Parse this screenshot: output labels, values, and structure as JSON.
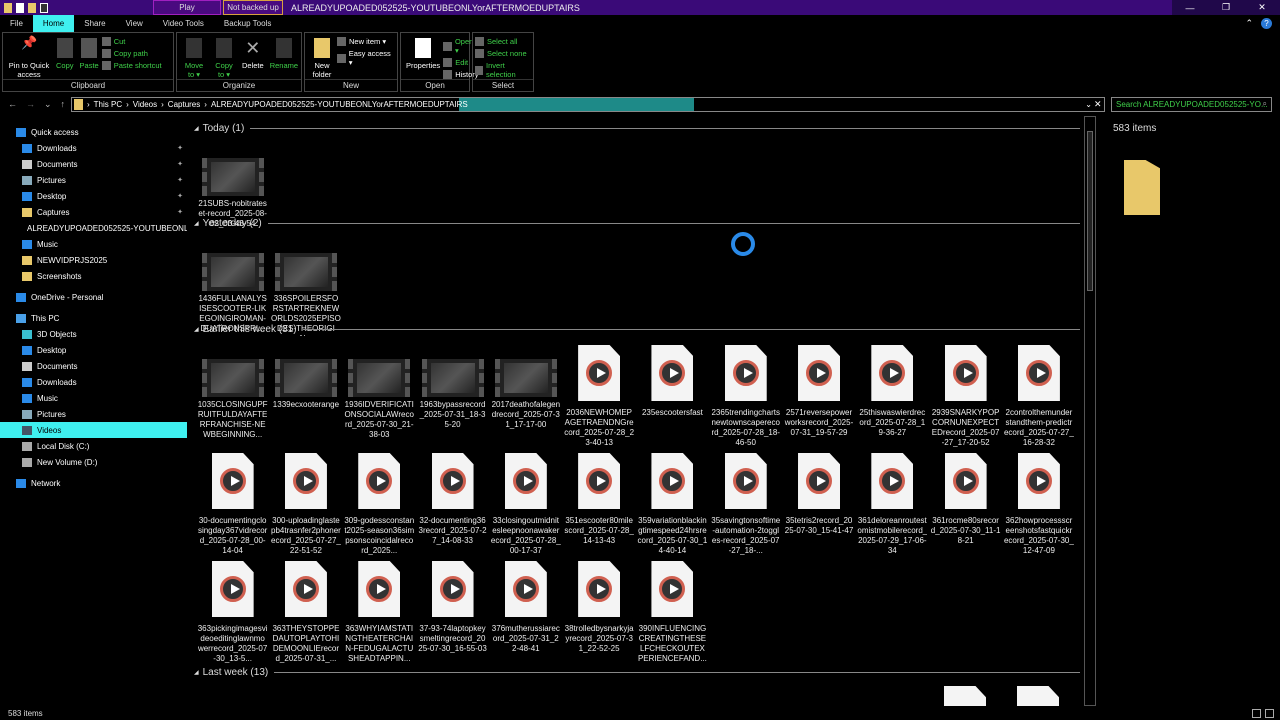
{
  "titlebar": {
    "play": "Play",
    "not_backed_up": "Not backed up",
    "title": "ALREADYUPOADED052525-YOUTUBEONLYorAFTERMOEDUPTAIRS",
    "min": "—",
    "max": "❐",
    "close": "✕"
  },
  "tabs": [
    "File",
    "Home",
    "Share",
    "View",
    "Video Tools",
    "Backup Tools"
  ],
  "ribbon": {
    "clipboard": {
      "label": "Clipboard",
      "pin": "Pin to Quick access",
      "copy": "Copy",
      "paste": "Paste",
      "cut": "Cut",
      "copy_path": "Copy path",
      "paste_shortcut": "Paste shortcut"
    },
    "organize": {
      "label": "Organize",
      "move_to": "Move to ▾",
      "copy_to": "Copy to ▾",
      "delete": "Delete",
      "rename": "Rename"
    },
    "new": {
      "label": "New",
      "new_folder": "New folder",
      "new_item": "New item ▾",
      "easy_access": "Easy access ▾"
    },
    "open": {
      "label": "Open",
      "properties": "Properties",
      "open": "Open ▾",
      "edit": "Edit",
      "history": "History"
    },
    "select": {
      "label": "Select",
      "select_all": "Select all",
      "select_none": "Select none",
      "invert": "Invert selection"
    }
  },
  "address": {
    "path": [
      "This PC",
      "Videos",
      "Captures",
      "ALREADYUPOADED052525-YOUTUBEONLYorAFTERMOEDUPTAIRS"
    ],
    "search_placeholder": "Search ALREADYUPOADED052525-YO..."
  },
  "sidebar": [
    {
      "label": "Quick access",
      "level": 0,
      "color": "#2a8ae8"
    },
    {
      "label": "Downloads",
      "level": 1,
      "pin": true,
      "color": "#2a8ae8"
    },
    {
      "label": "Documents",
      "level": 1,
      "pin": true,
      "color": "#ccc"
    },
    {
      "label": "Pictures",
      "level": 1,
      "pin": true,
      "color": "#8ab"
    },
    {
      "label": "Desktop",
      "level": 1,
      "pin": true,
      "color": "#2a8ae8"
    },
    {
      "label": "Captures",
      "level": 1,
      "pin": true,
      "color": "#e8c86a"
    },
    {
      "label": "ALREADYUPOADED052525-YOUTUBEONLYorAFTERMOEDUPTAIRS",
      "level": 1,
      "color": "#e8c86a"
    },
    {
      "label": "Music",
      "level": 1,
      "color": "#2a8ae8"
    },
    {
      "label": "NEWVIDPRJS2025",
      "level": 1,
      "color": "#e8c86a"
    },
    {
      "label": "Screenshots",
      "level": 1,
      "color": "#e8c86a"
    },
    {
      "label": "OneDrive - Personal",
      "level": 0,
      "gap": true,
      "color": "#2a8ae8"
    },
    {
      "label": "This PC",
      "level": 0,
      "gap": true,
      "color": "#4aa0e8"
    },
    {
      "label": "3D Objects",
      "level": 1,
      "color": "#3ac0d0"
    },
    {
      "label": "Desktop",
      "level": 1,
      "color": "#2a8ae8"
    },
    {
      "label": "Documents",
      "level": 1,
      "color": "#ccc"
    },
    {
      "label": "Downloads",
      "level": 1,
      "color": "#2a8ae8"
    },
    {
      "label": "Music",
      "level": 1,
      "color": "#2a8ae8"
    },
    {
      "label": "Pictures",
      "level": 1,
      "color": "#8ab"
    },
    {
      "label": "Videos",
      "level": 1,
      "selected": true,
      "color": "#456"
    },
    {
      "label": "Local Disk (C:)",
      "level": 1,
      "color": "#aaa"
    },
    {
      "label": "New Volume (D:)",
      "level": 1,
      "color": "#aaa"
    },
    {
      "label": "Network",
      "level": 0,
      "gap": true,
      "color": "#2a8ae8"
    }
  ],
  "groups": [
    {
      "title": "Today (1)",
      "items": [
        {
          "name": "21SUBS-nobitrateset-record_2025-08-02_03-43-54",
          "type": "video"
        }
      ]
    },
    {
      "title": "Yesterday (2)",
      "items": [
        {
          "name": "1436FULLANALYSISESCOOTER-LIKEGOINGIROMAN-DUATRONSPRI...",
          "type": "video"
        },
        {
          "name": "336SPOILERSFORSTARTREKNEWORLDS2025EPISODES-THEORIGIN...",
          "type": "video"
        }
      ]
    },
    {
      "title": "Earlier this week (31)",
      "items": [
        {
          "name": "1035CLOSINGUPFRUITFULDAYAFTERFRANCHISE-NEWBEGINNING...",
          "type": "video"
        },
        {
          "name": "1339ecxooterange",
          "type": "video"
        },
        {
          "name": "1936IDVERIFICATIONSOCIALAWrecord_2025-07-30_21-38-03",
          "type": "video"
        },
        {
          "name": "1963bypassrecord_2025-07-31_18-35-20",
          "type": "video"
        },
        {
          "name": "2017deathofalegendrecord_2025-07-31_17-17-00",
          "type": "video"
        },
        {
          "name": "2036NEWHOMEPAGETRAENDNGrecord_2025-07-28_23-40-13",
          "type": "file"
        },
        {
          "name": "235escootersfast",
          "type": "file"
        },
        {
          "name": "2365trendingchartsnewtownscaperecord_2025-07-28_18-46-50",
          "type": "file"
        },
        {
          "name": "2571reversepowerworksrecord_2025-07-31_19-57-29",
          "type": "file"
        },
        {
          "name": "25thiswaswierdrecord_2025-07-28_19-36-27",
          "type": "file"
        },
        {
          "name": "2939SNARKYPOPCORNUNEXPECTEDrecord_2025-07-27_17-20-52",
          "type": "file"
        },
        {
          "name": "2controlthemunderstandthem-predictrecord_2025-07-27_16-28-32",
          "type": "file"
        },
        {
          "name": "30-documentingclosingday367vidrecord_2025-07-28_00-14-04",
          "type": "file"
        },
        {
          "name": "300-uploadinglastepb4trasnfer2phonerecord_2025-07-27_22-51-52",
          "type": "file"
        },
        {
          "name": "309-godessconstant2025-season36simpsonscoincidalrecord_2025...",
          "type": "file"
        },
        {
          "name": "32-documenting363record_2025-07-27_14-08-33",
          "type": "file"
        },
        {
          "name": "33closingoutmidnitesleepnoonawakerecord_2025-07-28_00-17-37",
          "type": "file"
        },
        {
          "name": "351escooter80milescord_2025-07-28_14-13-43",
          "type": "file"
        },
        {
          "name": "359variationblackingtimespeed24hrsrecord_2025-07-30_14-40-14",
          "type": "file"
        },
        {
          "name": "35savingtonsoftime-automation-2toggles-record_2025-07-27_18-...",
          "type": "file"
        },
        {
          "name": "35tetris2record_2025-07-30_15-41-47",
          "type": "file"
        },
        {
          "name": "361deloreanroutestomistmobilerecord_2025-07-29_17-06-34",
          "type": "file"
        },
        {
          "name": "361rocme80srecord_2025-07-30_11-18-21",
          "type": "file"
        },
        {
          "name": "362howprocessscreenshotsfastquickrecord_2025-07-30_12-47-09",
          "type": "file"
        },
        {
          "name": "363pickingimagesvideoeditinglawnmowerrecord_2025-07-30_13-5...",
          "type": "file"
        },
        {
          "name": "363THEYSTOPPEDAUTOPLAYTOHIDEMOONLIErecord_2025-07-31_...",
          "type": "file"
        },
        {
          "name": "363WHYIAMSTATINGTHEATERCHAIN-FEDUGALACTUSHEADTAPPIN...",
          "type": "file"
        },
        {
          "name": "37-93-74laptopkeysmeltingrecord_2025-07-30_16-55-03",
          "type": "file"
        },
        {
          "name": "376mutherussiarecord_2025-07-31_22-48-41",
          "type": "file"
        },
        {
          "name": "38trolledbysnarkyjayrecord_2025-07-31_22-52-25",
          "type": "file"
        },
        {
          "name": "390INFLUENCINGCREATINGTHESELFCHECKOUTEXPERIENCEFAND...",
          "type": "file"
        }
      ]
    },
    {
      "title": "Last week (13)",
      "items": []
    }
  ],
  "details": {
    "count": "583 items"
  },
  "status": {
    "count": "583 items"
  }
}
